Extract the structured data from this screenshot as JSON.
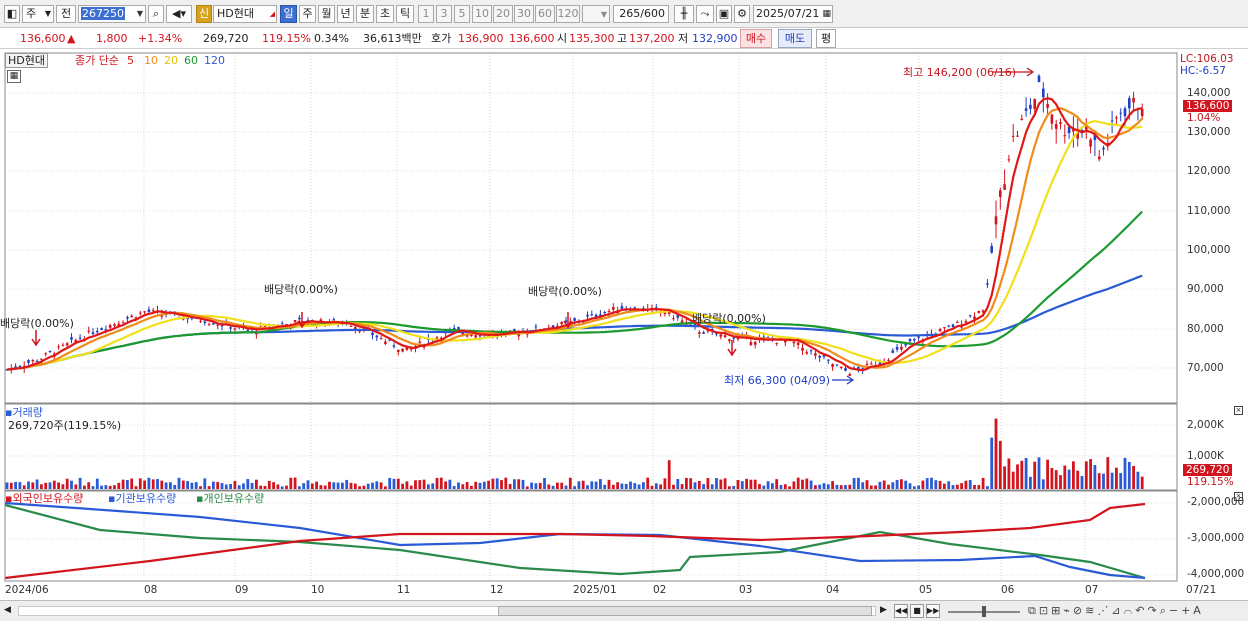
{
  "toolbar": {
    "period_select": "주",
    "prev_label": "전",
    "code": "267250",
    "badge": "신",
    "name": "HD현대",
    "periods": [
      "일",
      "주",
      "월",
      "년",
      "분",
      "초",
      "틱"
    ],
    "intervals": [
      "1",
      "3",
      "5",
      "10",
      "20",
      "30",
      "60",
      "120"
    ],
    "count": "265",
    "count_total": "/600",
    "date": "2025/07/21"
  },
  "quote": {
    "price": "136,600",
    "arrow": "▲",
    "change": "1,800",
    "change_pct": "+1.34%",
    "volume": "269,720",
    "volume_ratio": "119.15%",
    "turnover": "0.34%",
    "amount": "36,613백만",
    "bid_label": "호가",
    "bid": "136,900",
    "ask": "136,600",
    "open_label": "시",
    "open": "135,300",
    "high_label": "고",
    "high": "137,200",
    "low_label": "저",
    "low": "132,900",
    "buy_label": "매수",
    "sell_label": "매도",
    "avg_label": "평"
  },
  "price_panel": {
    "ticker_tag": "HD현대",
    "legend_prefix": "종가 단순",
    "ma_labels": [
      "5",
      "10",
      "20",
      "60",
      "120"
    ],
    "ma_colors": [
      "#e01818",
      "#f08c1a",
      "#f0e01a",
      "#1c9a2e",
      "#2a5ad6"
    ],
    "lc": "LC:106.03",
    "hc": "HC:-6.57",
    "last_price": "136,600",
    "last_pct": "1.04%",
    "high_note": "최고 146,200 (06/16)",
    "low_note": "최저 66,300 (04/09)",
    "dividend_notes": [
      "배당락(0.00%)",
      "배당락(0.00%)",
      "배당락(0.00%)",
      "배당락(0.00%)"
    ],
    "y_ticks": [
      "140,000",
      "130,000",
      "120,000",
      "110,000",
      "100,000",
      "90,000",
      "80,000",
      "70,000"
    ]
  },
  "volume_panel": {
    "title": "거래량",
    "value": "269,720주(119.15%)",
    "y_ticks": [
      "2,000K",
      "1,000K"
    ],
    "last": "269,720",
    "last_pct": "119.15%"
  },
  "holdings_panel": {
    "legend": [
      "외국인보유수량",
      "기관보유수량",
      "개인보유수량"
    ],
    "legend_colors": [
      "#d2141e",
      "#2a5ad6",
      "#2a8a4a"
    ],
    "y_ticks": [
      "-2,000,000",
      "-3,000,000",
      "-4,000,000"
    ]
  },
  "x_axis": [
    "2024/06",
    "08",
    "09",
    "10",
    "11",
    "12",
    "2025/01",
    "02",
    "03",
    "04",
    "05",
    "06",
    "07",
    "07/21"
  ]
}
